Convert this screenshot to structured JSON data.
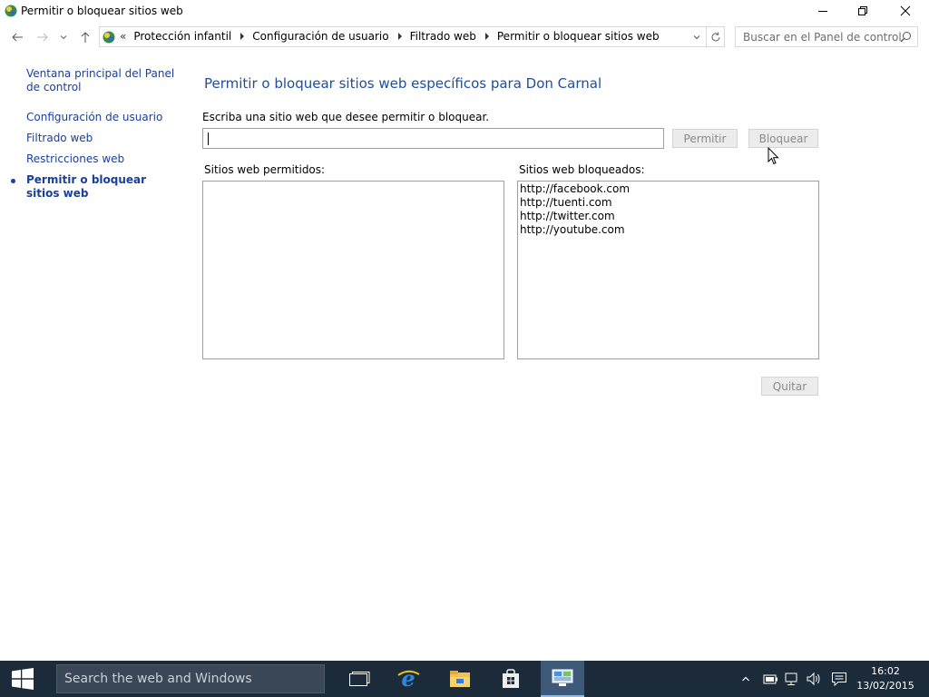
{
  "window": {
    "title": "Permitir o bloquear sitios web"
  },
  "address_bar": {
    "overflow": "«",
    "breadcrumbs": [
      "Protección infantil",
      "Configuración de usuario",
      "Filtrado web",
      "Permitir o bloquear sitios web"
    ]
  },
  "search": {
    "placeholder": "Buscar en el Panel de control"
  },
  "left_nav": {
    "items": [
      {
        "label": "Ventana principal del Panel de control"
      },
      {
        "label": "Configuración de usuario"
      },
      {
        "label": "Filtrado web"
      },
      {
        "label": "Restricciones web"
      },
      {
        "label": "Permitir o bloquear sitios web"
      }
    ]
  },
  "main": {
    "heading": "Permitir o bloquear sitios web específicos para Don Carnal",
    "prompt": "Escriba una sitio web que desee permitir o bloquear.",
    "site_input_value": "",
    "permit_button": "Permitir",
    "block_button": "Bloquear",
    "allowed_label": "Sitios web permitidos:",
    "blocked_label": "Sitios web bloqueados:",
    "allowed_sites": [],
    "blocked_sites": [
      "http://facebook.com",
      "http://tuenti.com",
      "http://twitter.com",
      "http://youtube.com"
    ],
    "remove_button": "Quitar"
  },
  "taskbar": {
    "search_placeholder": "Search the web and Windows",
    "time": "16:02",
    "date": "13/02/2015"
  },
  "colors": {
    "link": "#1a3f9b",
    "heading": "#1f4e9c",
    "taskbar": "#1c2b3a"
  },
  "icons": [
    "control-panel-icon",
    "minimize-icon",
    "maximize-icon",
    "close-icon",
    "back-arrow-icon",
    "forward-arrow-icon",
    "recent-dropdown-icon",
    "up-arrow-icon",
    "refresh-icon",
    "search-icon",
    "windows-start-icon",
    "task-view-icon",
    "edge-icon",
    "file-explorer-icon",
    "store-icon",
    "network-control-icon",
    "tray-chevron-icon",
    "battery-icon",
    "network-icon",
    "volume-icon",
    "notification-icon"
  ]
}
